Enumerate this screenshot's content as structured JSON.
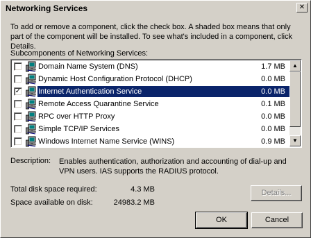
{
  "window": {
    "title": "Networking Services"
  },
  "instructions": "To add or remove a component, click the check box. A shaded box means that only part of the component will be installed. To see what's included in a component, click Details.",
  "subcomponents_label": "Subcomponents of Networking Services:",
  "items": [
    {
      "name": "Domain Name System (DNS)",
      "size": "1.7 MB",
      "checked": false,
      "selected": false
    },
    {
      "name": "Dynamic Host Configuration Protocol (DHCP)",
      "size": "0.0 MB",
      "checked": false,
      "selected": false
    },
    {
      "name": "Internet Authentication Service",
      "size": "0.0 MB",
      "checked": true,
      "selected": true
    },
    {
      "name": "Remote Access Quarantine Service",
      "size": "0.1 MB",
      "checked": false,
      "selected": false
    },
    {
      "name": "RPC over HTTP Proxy",
      "size": "0.0 MB",
      "checked": false,
      "selected": false
    },
    {
      "name": "Simple TCP/IP Services",
      "size": "0.0 MB",
      "checked": false,
      "selected": false
    },
    {
      "name": "Windows Internet Name Service (WINS)",
      "size": "0.9 MB",
      "checked": false,
      "selected": false
    }
  ],
  "description": {
    "label": "Description:",
    "text": "Enables authentication, authorization and accounting of dial-up and VPN users. IAS supports the RADIUS protocol."
  },
  "disk": {
    "required_label": "Total disk space required:",
    "required_value": "4.3 MB",
    "available_label": "Space available on disk:",
    "available_value": "24983.2 MB"
  },
  "buttons": {
    "details": "Details...",
    "ok": "OK",
    "cancel": "Cancel"
  },
  "icons": {
    "close": "close-icon",
    "item": "network-computer-icon",
    "check": "checkmark-icon"
  },
  "colors": {
    "selection": "#0a246a",
    "face": "#d4d0c8"
  }
}
